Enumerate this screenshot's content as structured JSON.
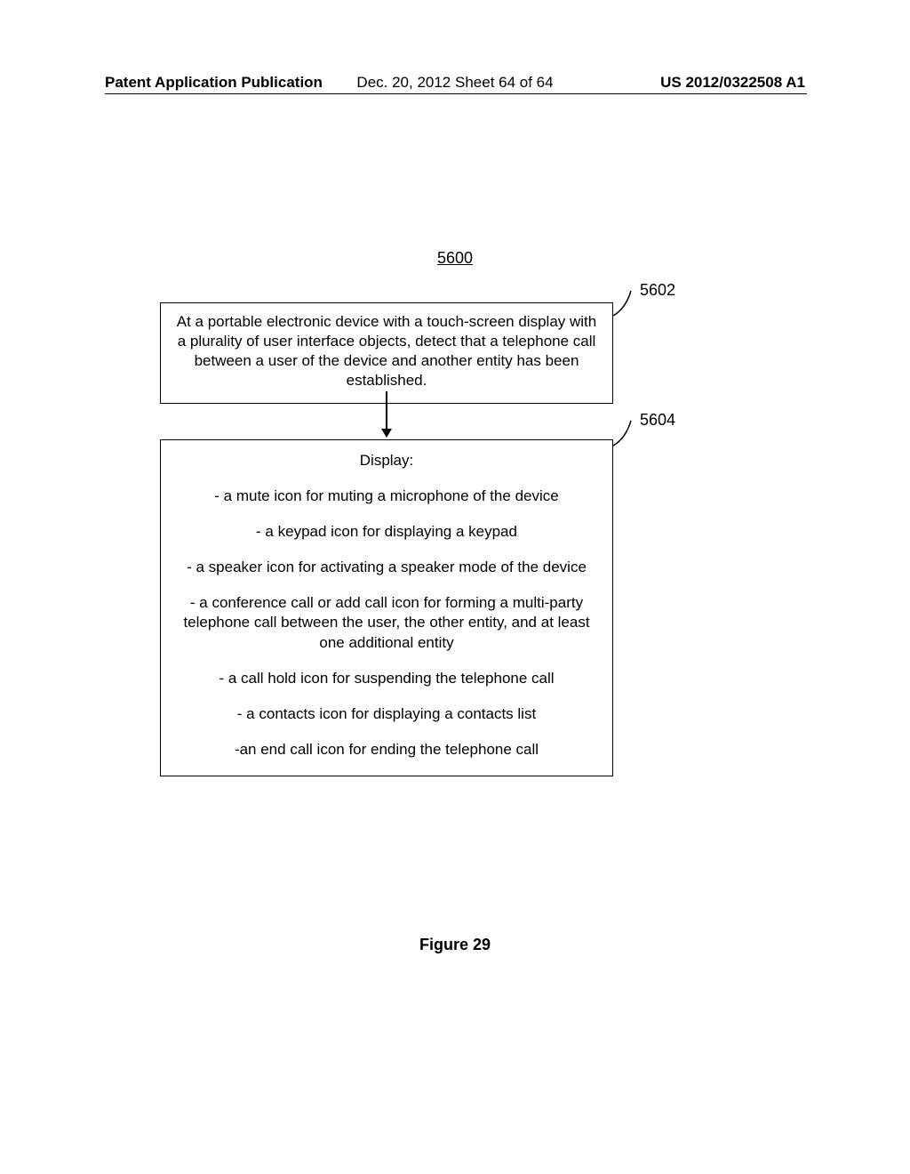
{
  "header": {
    "left": "Patent Application Publication",
    "center": "Dec. 20, 2012  Sheet 64 of 64",
    "right": "US 2012/0322508 A1"
  },
  "diagram_number": "5600",
  "box1": {
    "text": "At a portable electronic device with a touch-screen display with a plurality of user interface objects, detect that a telephone call between a user of the device and another entity has been established.",
    "ref": "5602"
  },
  "box2": {
    "header": "Display:",
    "items": [
      "- a mute icon for muting a microphone of the device",
      "- a keypad icon for displaying a keypad",
      "- a speaker icon for activating a speaker mode of the device",
      "- a conference call or add call icon for forming a multi-party telephone call between the user, the other entity, and at least one additional entity",
      "- a call hold icon for suspending the telephone call",
      "- a contacts icon for displaying a contacts list",
      "-an end call icon for ending the telephone call"
    ],
    "ref": "5604"
  },
  "figure_caption": "Figure 29"
}
